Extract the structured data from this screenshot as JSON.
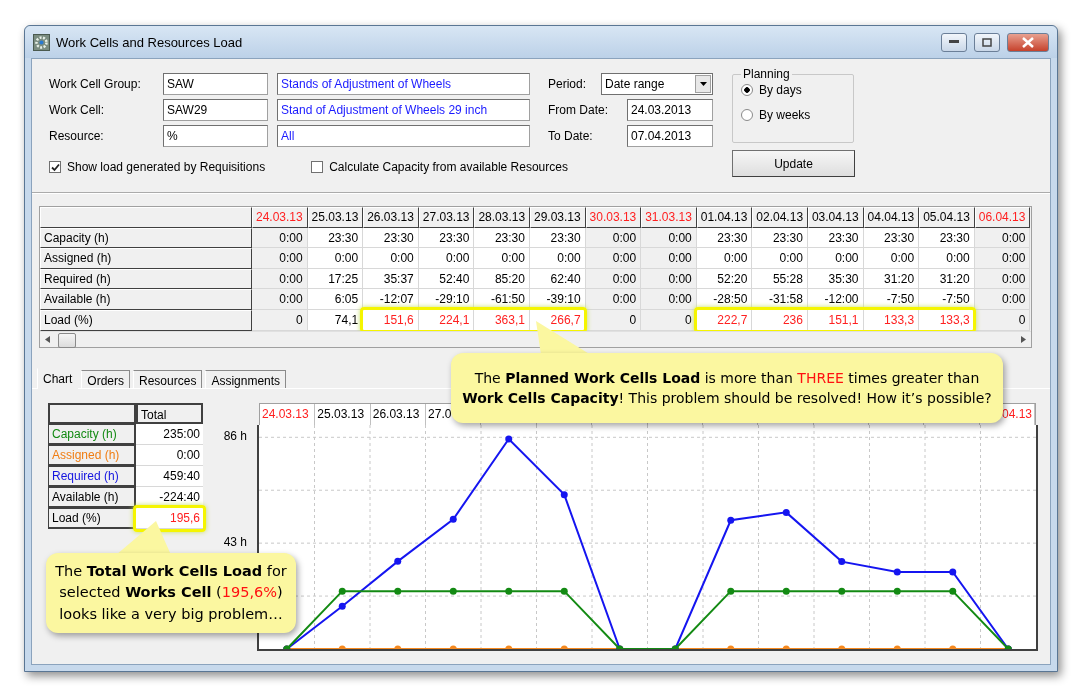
{
  "window": {
    "title": "Work Cells and Resources Load"
  },
  "filters": [
    {
      "label": "Work Cell Group:",
      "code": "SAW",
      "description": "Stands of Adjustment of Wheels"
    },
    {
      "label": "Work Cell:",
      "code": "SAW29",
      "description": "Stand of Adjustment of Wheels 29 inch"
    },
    {
      "label": "Resource:",
      "code": "%",
      "description": "All"
    }
  ],
  "checkboxes": [
    {
      "label": "Show load generated by Requisitions",
      "checked": true
    },
    {
      "label": "Calculate Capacity from available Resources",
      "checked": false
    }
  ],
  "period": {
    "label": "Period:",
    "value": "Date range"
  },
  "dates": [
    {
      "label": "From Date:",
      "value": "24.03.2013"
    },
    {
      "label": "To Date:",
      "value": "07.04.2013"
    }
  ],
  "planning": {
    "title": "Planning",
    "options": [
      {
        "label": "By days",
        "selected": true
      },
      {
        "label": "By weeks",
        "selected": false
      }
    ]
  },
  "update_button": "Update",
  "grid": {
    "columns": [
      {
        "label": "24.03.13",
        "weekend": true
      },
      {
        "label": "25.03.13",
        "weekend": false
      },
      {
        "label": "26.03.13",
        "weekend": false
      },
      {
        "label": "27.03.13",
        "weekend": false
      },
      {
        "label": "28.03.13",
        "weekend": false
      },
      {
        "label": "29.03.13",
        "weekend": false
      },
      {
        "label": "30.03.13",
        "weekend": true
      },
      {
        "label": "31.03.13",
        "weekend": true
      },
      {
        "label": "01.04.13",
        "weekend": false
      },
      {
        "label": "02.04.13",
        "weekend": false
      },
      {
        "label": "03.04.13",
        "weekend": false
      },
      {
        "label": "04.04.13",
        "weekend": false
      },
      {
        "label": "05.04.13",
        "weekend": false
      },
      {
        "label": "06.04.13",
        "weekend": true
      }
    ],
    "rows": [
      {
        "label": "Capacity (h)",
        "cells": [
          "0:00",
          "23:30",
          "23:30",
          "23:30",
          "23:30",
          "23:30",
          "0:00",
          "0:00",
          "23:30",
          "23:30",
          "23:30",
          "23:30",
          "23:30",
          "0:00"
        ]
      },
      {
        "label": "Assigned (h)",
        "cells": [
          "0:00",
          "0:00",
          "0:00",
          "0:00",
          "0:00",
          "0:00",
          "0:00",
          "0:00",
          "0:00",
          "0:00",
          "0:00",
          "0:00",
          "0:00",
          "0:00"
        ]
      },
      {
        "label": "Required (h)",
        "cells": [
          "0:00",
          "17:25",
          "35:37",
          "52:40",
          "85:20",
          "62:40",
          "0:00",
          "0:00",
          "52:20",
          "55:28",
          "35:30",
          "31:20",
          "31:20",
          "0:00"
        ]
      },
      {
        "label": "Available (h)",
        "cells": [
          "0:00",
          "6:05",
          "-12:07",
          "-29:10",
          "-61:50",
          "-39:10",
          "0:00",
          "0:00",
          "-28:50",
          "-31:58",
          "-12:00",
          "-7:50",
          "-7:50",
          "0:00"
        ]
      },
      {
        "label": "Load (%)",
        "cells": [
          "0",
          "74,1",
          "151,6",
          "224,1",
          "363,1",
          "266,7",
          "0",
          "0",
          "222,7",
          "236",
          "151,1",
          "133,3",
          "133,3",
          "0"
        ],
        "highlighted": [
          false,
          false,
          true,
          true,
          true,
          true,
          false,
          false,
          true,
          true,
          true,
          true,
          true,
          false
        ]
      }
    ]
  },
  "tabs": [
    {
      "label": "Chart",
      "selected": true
    },
    {
      "label": "Orders",
      "selected": false
    },
    {
      "label": "Resources",
      "selected": false
    },
    {
      "label": "Assignments",
      "selected": false
    }
  ],
  "summary": {
    "column": "Total",
    "rows": [
      {
        "label": "Capacity (h)",
        "value": "235:00",
        "color": "#138a13",
        "highlighted": false
      },
      {
        "label": "Assigned (h)",
        "value": "0:00",
        "color": "#f07d12",
        "highlighted": false
      },
      {
        "label": "Required (h)",
        "value": "459:40",
        "color": "#1515e0",
        "highlighted": false
      },
      {
        "label": "Available (h)",
        "value": "-224:40",
        "color": "#000000",
        "highlighted": false
      },
      {
        "label": "Load (%)",
        "value": "195,6",
        "color": "#000000",
        "highlighted": true
      }
    ]
  },
  "chart": {
    "header_start": [
      {
        "label": "24.03.13",
        "weekend": true
      },
      {
        "label": "25.03.13",
        "weekend": false
      },
      {
        "label": "26.03.13",
        "weekend": false
      },
      {
        "label": "27.0",
        "weekend": false
      }
    ],
    "header_end": [
      {
        "label": ".04.13",
        "weekend": true
      }
    ],
    "chart_data": {
      "type": "line",
      "ylim": [
        0,
        91
      ],
      "yticks": [
        {
          "value": 43,
          "label": "43 h"
        },
        {
          "value": 86,
          "label": "86 h"
        }
      ],
      "series": [
        {
          "color": "#138a13",
          "marker": "circle",
          "values": [
            0,
            23.5,
            23.5,
            23.5,
            23.5,
            23.5,
            0,
            0,
            23.5,
            23.5,
            23.5,
            23.5,
            23.5,
            0
          ]
        },
        {
          "color": "#1515f0",
          "marker": "circle",
          "values": [
            0,
            17.4,
            35.6,
            52.7,
            85.3,
            62.7,
            0,
            0,
            52.3,
            55.5,
            35.5,
            31.3,
            31.3,
            0
          ]
        },
        {
          "color": "#f5891f",
          "marker": "circle",
          "values": [
            0,
            0,
            0,
            0,
            0,
            0,
            0,
            0,
            0,
            0,
            0,
            0,
            0,
            0
          ]
        }
      ]
    }
  },
  "callouts": [
    {
      "lines": [
        [
          {
            "text": "The ",
            "kind": "plain"
          },
          {
            "text": "Planned Work Cells Load",
            "kind": "strong"
          },
          {
            "text": " is more than ",
            "kind": "plain"
          },
          {
            "text": "THREE",
            "kind": "alert"
          },
          {
            "text": " times greater than",
            "kind": "plain"
          }
        ],
        [
          {
            "text": "Work Cells Capacity",
            "kind": "strong"
          },
          {
            "text": "! This problem should be resolved! How it’s possible?",
            "kind": "plain"
          }
        ]
      ]
    },
    {
      "lines": [
        [
          {
            "text": "The ",
            "kind": "plain"
          },
          {
            "text": "Total Work Cells Load",
            "kind": "strong"
          },
          {
            "text": " for",
            "kind": "plain"
          }
        ],
        [
          {
            "text": "selected ",
            "kind": "plain"
          },
          {
            "text": "Works Cell",
            "kind": "strong"
          },
          {
            "text": " (",
            "kind": "plain"
          },
          {
            "text": "195,6%",
            "kind": "alert"
          },
          {
            "text": ")",
            "kind": "plain"
          }
        ],
        [
          {
            "text": "looks like a very big problem…",
            "kind": "plain"
          }
        ]
      ]
    }
  ]
}
